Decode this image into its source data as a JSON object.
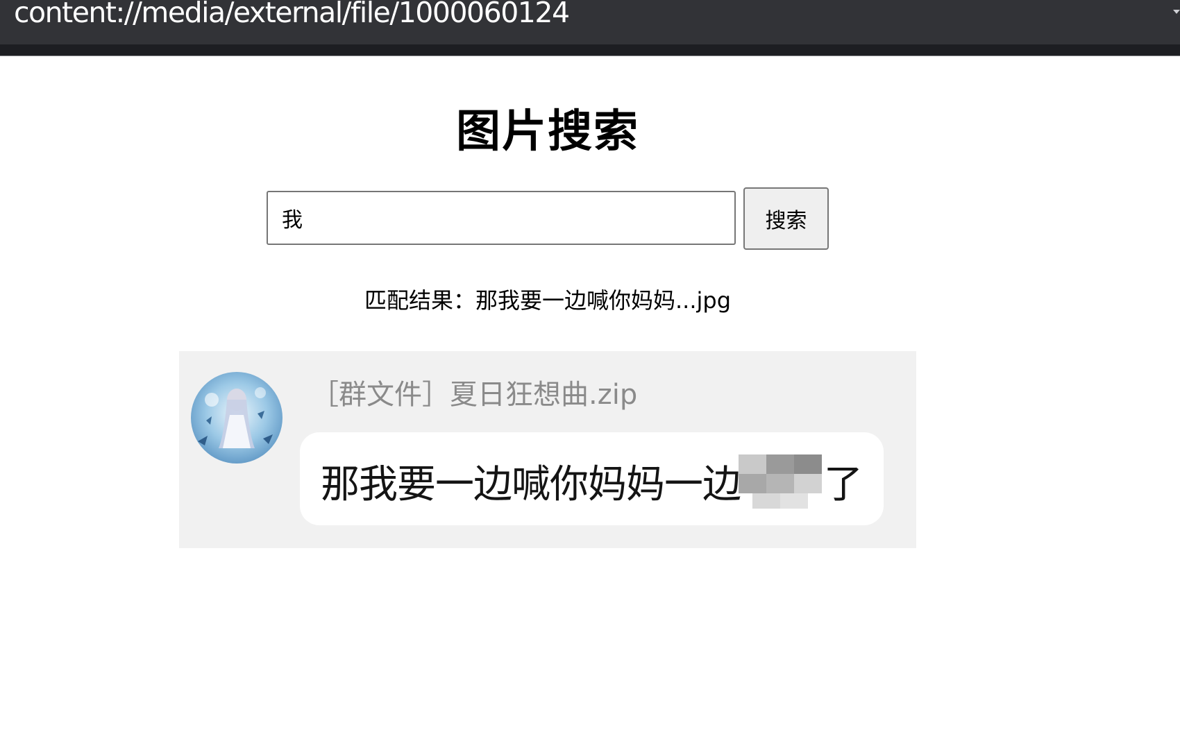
{
  "browser": {
    "url": "content://media/external/file/1000060124"
  },
  "page": {
    "title": "图片搜索"
  },
  "search": {
    "value": "我",
    "button_label": "搜索"
  },
  "result": {
    "text": "匹配结果：那我要一边喊你妈妈...jpg"
  },
  "result_image": {
    "file_label": "［群文件］夏日狂想曲.zip",
    "message_before_redaction": "那我要一边喊你妈妈一边",
    "message_after_redaction": "了",
    "avatar_icon": "anime-avatar-icon",
    "colors": {
      "background": "#f1f1f1",
      "bubble": "#ffffff",
      "redaction": "#8c8c8c"
    }
  }
}
